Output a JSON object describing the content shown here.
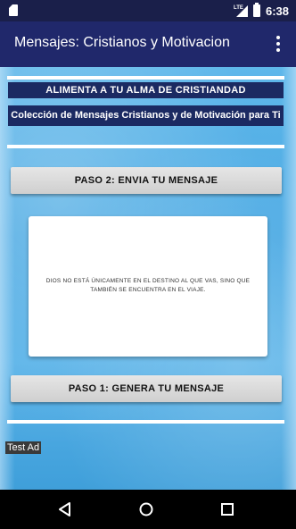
{
  "status_bar": {
    "network": "LTE",
    "time": "6:38",
    "icons": [
      "sd-card-icon",
      "signal-icon",
      "battery-icon"
    ]
  },
  "app_bar": {
    "title": "Mensajes: Cristianos y Motivacion",
    "menu_icon": "more-vert-icon"
  },
  "main": {
    "banner_title": "ALIMENTA A TU ALMA DE CRISTIANDAD",
    "banner_subtitle": "Colección de Mensajes Cristianos y de Motivación  para Ti",
    "send_button": "PASO 2:  ENVIA TU MENSAJE",
    "message_text": "Dios no está únicamente en el destino al que vas, sino que también se encuentra en el viaje.",
    "generate_button": "PASO 1:  GENERA TU MENSAJE",
    "ad_label": "Test Ad"
  },
  "nav_bar": {
    "icons": [
      "back-icon",
      "home-icon",
      "recents-icon"
    ]
  }
}
